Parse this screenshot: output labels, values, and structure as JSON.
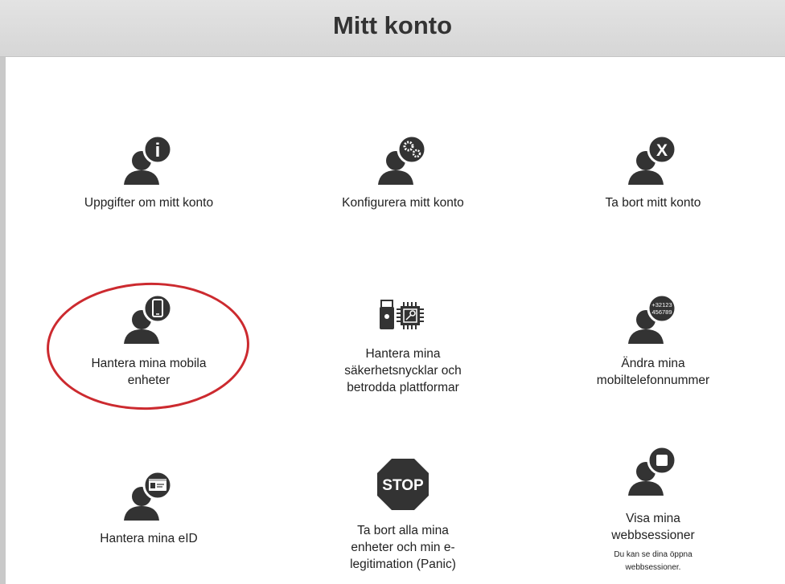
{
  "header": {
    "title": "Mitt konto"
  },
  "tiles": [
    {
      "label": "Uppgifter om mitt konto",
      "icon": "user-info-icon"
    },
    {
      "label": "Konfigurera mitt konto",
      "icon": "user-settings-icon"
    },
    {
      "label": "Ta bort mitt konto",
      "icon": "user-remove-icon"
    },
    {
      "label": "Hantera mina mobila enheter",
      "icon": "user-mobile-icon"
    },
    {
      "label": "Hantera mina säkerhetsnycklar och betrodda plattformar",
      "icon": "security-key-chip-icon"
    },
    {
      "label": "Ändra mina mobiltelefonnummer",
      "icon": "user-phone-number-icon",
      "badge": "+32123\n456789"
    },
    {
      "label": "Hantera mina eID",
      "icon": "user-eid-card-icon"
    },
    {
      "label": "Ta bort alla mina enheter och min e-legitimation (Panic)",
      "icon": "stop-sign-icon",
      "badge": "STOP"
    },
    {
      "label": "Visa mina webbsessioner",
      "icon": "user-session-icon",
      "sub": "Du kan se dina öppna webbsessioner."
    }
  ],
  "annotation": {
    "color": "#cc2a2f",
    "shape": "ellipse"
  }
}
